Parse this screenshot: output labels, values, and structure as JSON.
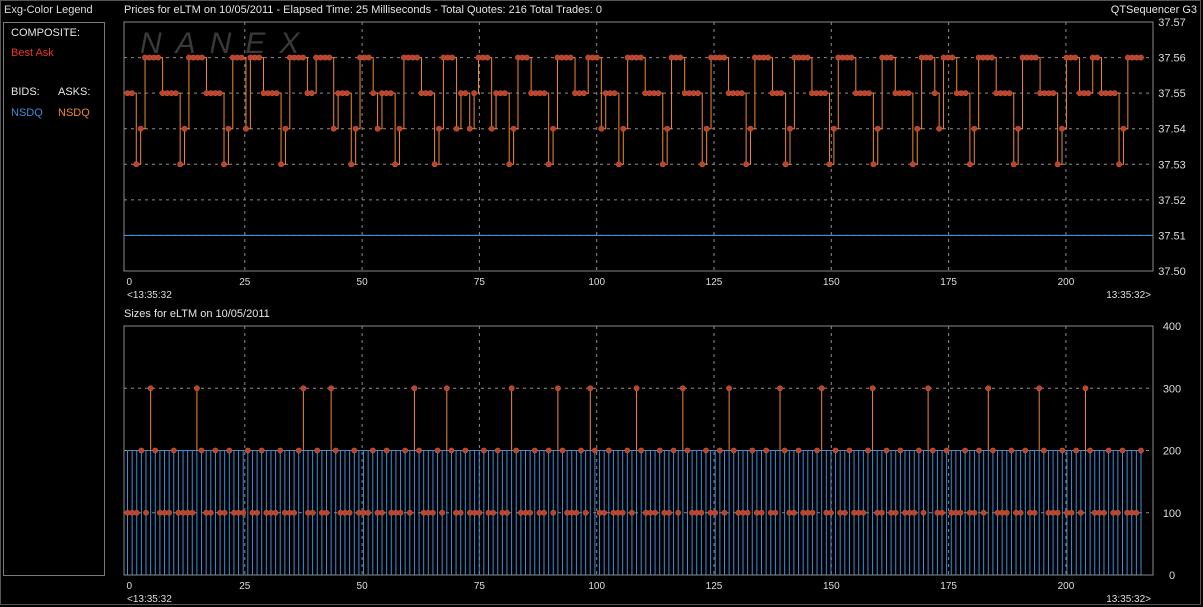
{
  "window": {
    "right_label": "QTSequencer G3"
  },
  "legend": {
    "title": "Exg-Color Legend",
    "composite_heading": "COMPOSITE:",
    "composite_item": {
      "label": "Best Ask",
      "color": "#e8342a"
    },
    "bids_heading": "BIDS:",
    "asks_heading": "ASKS:",
    "bid_item": {
      "label": "NSDQ",
      "color": "#3f8ed8"
    },
    "ask_item": {
      "label": "NSDQ",
      "color": "#ef8a2a"
    }
  },
  "watermark": "NANEX",
  "chart_data": [
    {
      "type": "line",
      "title": "Prices for  eLTM  on  10/05/2011   -  Elapsed Time: 25 Milliseconds   -  Total Quotes: 216  Total Trades: 0",
      "x_ticks": [
        0,
        25,
        50,
        75,
        100,
        125,
        150,
        175,
        200
      ],
      "xlim": [
        0,
        216
      ],
      "time_start": "<13:35:32",
      "time_end": "13:35:32>",
      "y_ticks": [
        "37.57",
        "37.56",
        "37.55",
        "37.54",
        "37.53",
        "37.52",
        "37.51",
        "37.50"
      ],
      "ylim": [
        37.5,
        37.57
      ],
      "grid": true,
      "series": [
        {
          "color": "#ef8a2a",
          "step": true,
          "markers": true,
          "values": [
            37.55,
            37.55,
            37.53,
            37.54,
            37.56,
            37.56,
            37.56,
            37.56,
            37.55,
            37.55,
            37.55,
            37.55,
            37.53,
            37.54,
            37.56,
            37.56,
            37.56,
            37.56,
            37.55,
            37.55,
            37.55,
            37.55,
            37.53,
            37.54,
            37.56,
            37.56,
            37.56,
            37.54,
            37.56,
            37.56,
            37.56,
            37.55,
            37.55,
            37.55,
            37.55,
            37.53,
            37.54,
            37.56,
            37.56,
            37.56,
            37.56,
            37.55,
            37.55,
            37.56,
            37.56,
            37.56,
            37.56,
            37.54,
            37.55,
            37.55,
            37.55,
            37.53,
            37.54,
            37.56,
            37.56,
            37.56,
            37.55,
            37.54,
            37.55,
            37.55,
            37.55,
            37.53,
            37.54,
            37.56,
            37.56,
            37.56,
            37.56,
            37.55,
            37.55,
            37.55,
            37.53,
            37.54,
            37.56,
            37.56,
            37.56,
            37.54,
            37.55,
            37.55,
            37.54,
            37.55,
            37.56,
            37.56,
            37.56,
            37.54,
            37.55,
            37.55,
            37.55,
            37.53,
            37.54,
            37.56,
            37.56,
            37.56,
            37.55,
            37.55,
            37.55,
            37.55,
            37.53,
            37.54,
            37.56,
            37.56,
            37.56,
            37.56,
            37.55,
            37.55,
            37.55,
            37.56,
            37.56,
            37.56,
            37.54,
            37.55,
            37.55,
            37.55,
            37.53,
            37.54,
            37.56,
            37.56,
            37.56,
            37.56,
            37.55,
            37.55,
            37.55,
            37.55,
            37.53,
            37.54,
            37.56,
            37.56,
            37.56,
            37.55,
            37.55,
            37.55,
            37.55,
            37.53,
            37.54,
            37.56,
            37.56,
            37.56,
            37.56,
            37.55,
            37.55,
            37.55,
            37.55,
            37.53,
            37.54,
            37.56,
            37.56,
            37.56,
            37.56,
            37.55,
            37.55,
            37.55,
            37.53,
            37.54,
            37.56,
            37.56,
            37.56,
            37.56,
            37.55,
            37.55,
            37.55,
            37.55,
            37.53,
            37.54,
            37.56,
            37.56,
            37.56,
            37.56,
            37.55,
            37.55,
            37.55,
            37.55,
            37.53,
            37.54,
            37.56,
            37.56,
            37.56,
            37.55,
            37.55,
            37.55,
            37.55,
            37.53,
            37.54,
            37.56,
            37.56,
            37.56,
            37.55,
            37.54,
            37.56,
            37.56,
            37.56,
            37.55,
            37.55,
            37.55,
            37.53,
            37.54,
            37.56,
            37.56,
            37.56,
            37.56,
            37.55,
            37.55,
            37.55,
            37.55,
            37.53,
            37.54,
            37.56,
            37.56,
            37.56,
            37.56,
            37.55,
            37.55,
            37.55,
            37.55,
            37.53,
            37.54,
            37.56,
            37.56,
            37.56,
            37.55,
            37.55,
            37.55,
            37.56,
            37.56,
            37.55,
            37.55,
            37.55,
            37.55,
            37.53,
            37.54,
            37.56,
            37.56,
            37.56,
            37.56
          ]
        },
        {
          "color": "#3f8ed8",
          "step": false,
          "markers": false,
          "values": [
            37.51,
            37.51
          ]
        }
      ]
    },
    {
      "type": "bar",
      "title": "Sizes for  eLTM  on  10/05/2011",
      "x_ticks": [
        0,
        25,
        50,
        75,
        100,
        125,
        150,
        175,
        200
      ],
      "xlim": [
        0,
        216
      ],
      "time_start": "<13:35:32",
      "time_end": "13:35:32>",
      "y_ticks": [
        "400",
        "300",
        "200",
        "100",
        "0"
      ],
      "ylim": [
        0,
        400
      ],
      "grid": true,
      "bid_color": "#3f8ed8",
      "ask_color": "#ef8a2a",
      "bid_size": 200,
      "ask_values": [
        100,
        100,
        100,
        200,
        100,
        300,
        200,
        100,
        100,
        100,
        200,
        100,
        100,
        100,
        100,
        300,
        200,
        100,
        100,
        200,
        100,
        100,
        200,
        100,
        100,
        100,
        200,
        100,
        100,
        200,
        100,
        100,
        100,
        200,
        100,
        100,
        100,
        200,
        300,
        100,
        100,
        200,
        100,
        100,
        300,
        200,
        100,
        100,
        100,
        200,
        100,
        100,
        100,
        200,
        100,
        100,
        200,
        100,
        100,
        100,
        200,
        100,
        300,
        200,
        100,
        100,
        100,
        200,
        100,
        300,
        200,
        100,
        100,
        200,
        100,
        100,
        100,
        200,
        100,
        100,
        200,
        100,
        100,
        300,
        200,
        100,
        100,
        100,
        200,
        100,
        100,
        200,
        100,
        300,
        200,
        100,
        100,
        100,
        200,
        100,
        300,
        200,
        100,
        100,
        200,
        100,
        100,
        100,
        200,
        100,
        300,
        200,
        100,
        100,
        100,
        200,
        100,
        100,
        200,
        100,
        300,
        200,
        100,
        100,
        100,
        200,
        100,
        100,
        200,
        100,
        300,
        200,
        100,
        100,
        100,
        200,
        100,
        100,
        200,
        100,
        100,
        300,
        200,
        100,
        100,
        200,
        100,
        100,
        100,
        200,
        300,
        100,
        100,
        200,
        100,
        100,
        200,
        100,
        100,
        100,
        200,
        300,
        100,
        100,
        200,
        100,
        100,
        200,
        100,
        100,
        100,
        200,
        100,
        300,
        200,
        100,
        100,
        200,
        100,
        100,
        100,
        200,
        100,
        100,
        200,
        100,
        300,
        200,
        100,
        100,
        100,
        200,
        100,
        100,
        200,
        100,
        100,
        300,
        200,
        100,
        100,
        100,
        200,
        100,
        100,
        200,
        100,
        300,
        200,
        100,
        100,
        100,
        200,
        100,
        100,
        200,
        100,
        100,
        100,
        200
      ]
    }
  ]
}
